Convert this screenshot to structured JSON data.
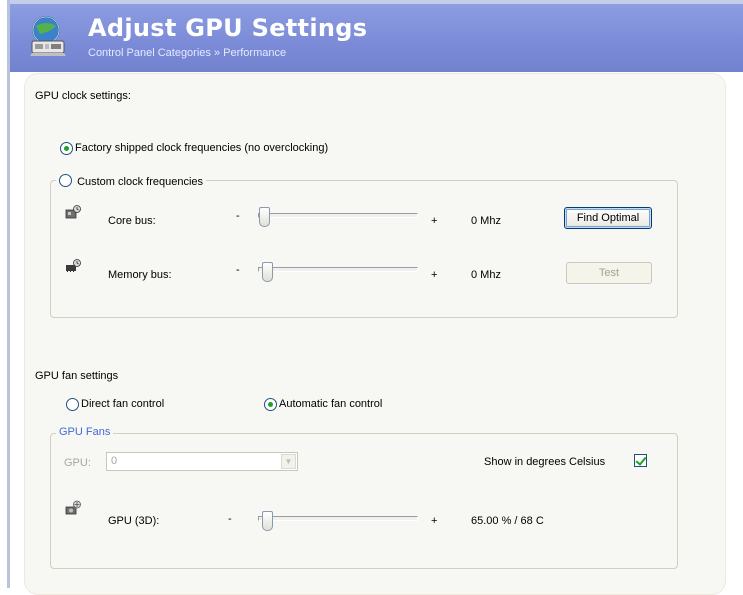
{
  "header": {
    "title": "Adjust GPU Settings",
    "breadcrumb": "Control Panel Categories » Performance"
  },
  "clock": {
    "section_title": "GPU clock settings:",
    "factory_label": "Factory shipped clock frequencies (no overclocking)",
    "factory_selected": true,
    "custom_label": "Custom clock frequencies",
    "custom_selected": false,
    "core": {
      "label": "Core bus:",
      "minus": "-",
      "plus": "+",
      "value": "0 Mhz",
      "level": 0
    },
    "memory": {
      "label": "Memory bus:",
      "minus": "-",
      "plus": "+",
      "value": "0 Mhz",
      "level": 0
    },
    "find_optimal_label": "Find Optimal",
    "test_label": "Test"
  },
  "fan": {
    "section_title": "GPU fan settings",
    "direct_label": "Direct fan control",
    "direct_selected": false,
    "automatic_label": "Automatic fan control",
    "automatic_selected": true,
    "group_title": "GPU Fans",
    "gpu_label": "GPU:",
    "gpu_value": "0",
    "celsius_label": "Show in degrees Celsius",
    "celsius_checked": true,
    "gpu3d": {
      "label": "GPU (3D):",
      "minus": "-",
      "plus": "+",
      "value": "65.00 % / 68 C",
      "level": 0
    }
  },
  "colors": {
    "header_bg": "#7b8bd7",
    "accent_green": "#21a121",
    "legend_blue": "#3f6bd6"
  },
  "icons": {
    "header": "gpu-chip-monitor-icon",
    "core": "gpu-clock-icon",
    "memory": "memory-clock-icon",
    "fan": "fan-icon"
  }
}
